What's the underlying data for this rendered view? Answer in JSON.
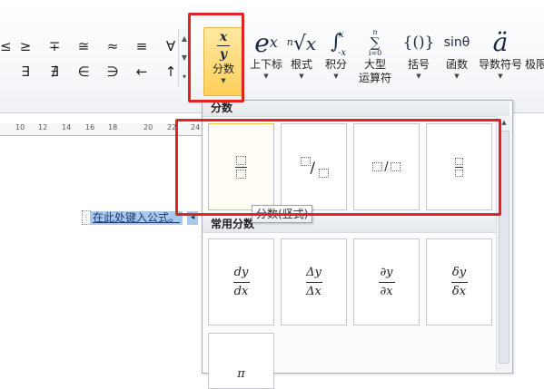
{
  "symbols": {
    "row1": [
      "≤",
      "≥",
      "∓",
      "≅",
      "≈",
      "≡",
      "∀"
    ],
    "row2": [
      "∃",
      "∄",
      "∈",
      "∋",
      "←",
      "↑"
    ]
  },
  "tools": {
    "fraction": {
      "numerator": "x",
      "denominator": "y",
      "label": "分数"
    },
    "script": {
      "icon_base": "e",
      "icon_sup": "x",
      "label": "上下标"
    },
    "radical": {
      "icon_index": "n",
      "icon_radicand": "x",
      "label": "根式"
    },
    "integral": {
      "icon_upper": "x",
      "icon_lower": "-x",
      "label": "积分"
    },
    "large_operator": {
      "icon_upper": "n",
      "icon_symbol": "∑",
      "icon_lower": "i=0",
      "label_line1": "大型",
      "label_line2": "运算符"
    },
    "bracket": {
      "icon": "{()}",
      "label": "括号"
    },
    "function": {
      "icon": "sinθ",
      "label": "函数"
    },
    "accent": {
      "icon": "ä",
      "label": "导数符号"
    },
    "limit": {
      "label": "极限"
    }
  },
  "ruler": {
    "ticks": [
      "10",
      "12",
      "14",
      "16",
      "18",
      "20",
      "22",
      "24"
    ]
  },
  "document": {
    "placeholder": "在此处键入公式。"
  },
  "gallery": {
    "section1_title": "分数",
    "section2_title": "常用分数",
    "tooltip": "分数(竖式)",
    "common": [
      {
        "num": "dy",
        "den": "dx"
      },
      {
        "num": "Δy",
        "den": "Δx"
      },
      {
        "num": "∂y",
        "den": "∂x"
      },
      {
        "num": "δy",
        "den": "δx"
      },
      {
        "num": "π",
        "den": ""
      }
    ]
  },
  "colors": {
    "highlight_red": "#e02424",
    "selected_button": "#ffd05a"
  }
}
